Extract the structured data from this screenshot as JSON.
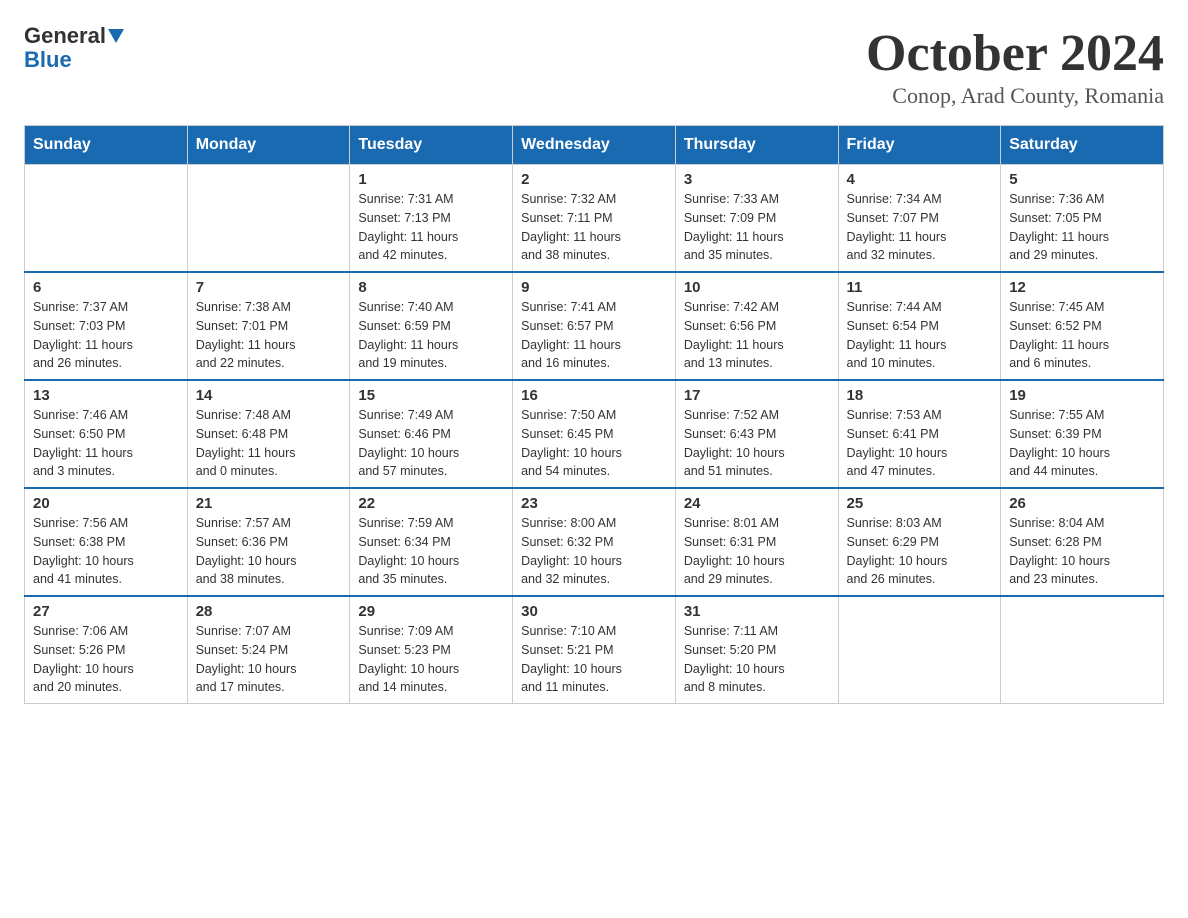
{
  "logo": {
    "general": "General",
    "blue": "Blue"
  },
  "title": "October 2024",
  "subtitle": "Conop, Arad County, Romania",
  "weekdays": [
    "Sunday",
    "Monday",
    "Tuesday",
    "Wednesday",
    "Thursday",
    "Friday",
    "Saturday"
  ],
  "weeks": [
    [
      {
        "day": "",
        "info": ""
      },
      {
        "day": "",
        "info": ""
      },
      {
        "day": "1",
        "info": "Sunrise: 7:31 AM\nSunset: 7:13 PM\nDaylight: 11 hours\nand 42 minutes."
      },
      {
        "day": "2",
        "info": "Sunrise: 7:32 AM\nSunset: 7:11 PM\nDaylight: 11 hours\nand 38 minutes."
      },
      {
        "day": "3",
        "info": "Sunrise: 7:33 AM\nSunset: 7:09 PM\nDaylight: 11 hours\nand 35 minutes."
      },
      {
        "day": "4",
        "info": "Sunrise: 7:34 AM\nSunset: 7:07 PM\nDaylight: 11 hours\nand 32 minutes."
      },
      {
        "day": "5",
        "info": "Sunrise: 7:36 AM\nSunset: 7:05 PM\nDaylight: 11 hours\nand 29 minutes."
      }
    ],
    [
      {
        "day": "6",
        "info": "Sunrise: 7:37 AM\nSunset: 7:03 PM\nDaylight: 11 hours\nand 26 minutes."
      },
      {
        "day": "7",
        "info": "Sunrise: 7:38 AM\nSunset: 7:01 PM\nDaylight: 11 hours\nand 22 minutes."
      },
      {
        "day": "8",
        "info": "Sunrise: 7:40 AM\nSunset: 6:59 PM\nDaylight: 11 hours\nand 19 minutes."
      },
      {
        "day": "9",
        "info": "Sunrise: 7:41 AM\nSunset: 6:57 PM\nDaylight: 11 hours\nand 16 minutes."
      },
      {
        "day": "10",
        "info": "Sunrise: 7:42 AM\nSunset: 6:56 PM\nDaylight: 11 hours\nand 13 minutes."
      },
      {
        "day": "11",
        "info": "Sunrise: 7:44 AM\nSunset: 6:54 PM\nDaylight: 11 hours\nand 10 minutes."
      },
      {
        "day": "12",
        "info": "Sunrise: 7:45 AM\nSunset: 6:52 PM\nDaylight: 11 hours\nand 6 minutes."
      }
    ],
    [
      {
        "day": "13",
        "info": "Sunrise: 7:46 AM\nSunset: 6:50 PM\nDaylight: 11 hours\nand 3 minutes."
      },
      {
        "day": "14",
        "info": "Sunrise: 7:48 AM\nSunset: 6:48 PM\nDaylight: 11 hours\nand 0 minutes."
      },
      {
        "day": "15",
        "info": "Sunrise: 7:49 AM\nSunset: 6:46 PM\nDaylight: 10 hours\nand 57 minutes."
      },
      {
        "day": "16",
        "info": "Sunrise: 7:50 AM\nSunset: 6:45 PM\nDaylight: 10 hours\nand 54 minutes."
      },
      {
        "day": "17",
        "info": "Sunrise: 7:52 AM\nSunset: 6:43 PM\nDaylight: 10 hours\nand 51 minutes."
      },
      {
        "day": "18",
        "info": "Sunrise: 7:53 AM\nSunset: 6:41 PM\nDaylight: 10 hours\nand 47 minutes."
      },
      {
        "day": "19",
        "info": "Sunrise: 7:55 AM\nSunset: 6:39 PM\nDaylight: 10 hours\nand 44 minutes."
      }
    ],
    [
      {
        "day": "20",
        "info": "Sunrise: 7:56 AM\nSunset: 6:38 PM\nDaylight: 10 hours\nand 41 minutes."
      },
      {
        "day": "21",
        "info": "Sunrise: 7:57 AM\nSunset: 6:36 PM\nDaylight: 10 hours\nand 38 minutes."
      },
      {
        "day": "22",
        "info": "Sunrise: 7:59 AM\nSunset: 6:34 PM\nDaylight: 10 hours\nand 35 minutes."
      },
      {
        "day": "23",
        "info": "Sunrise: 8:00 AM\nSunset: 6:32 PM\nDaylight: 10 hours\nand 32 minutes."
      },
      {
        "day": "24",
        "info": "Sunrise: 8:01 AM\nSunset: 6:31 PM\nDaylight: 10 hours\nand 29 minutes."
      },
      {
        "day": "25",
        "info": "Sunrise: 8:03 AM\nSunset: 6:29 PM\nDaylight: 10 hours\nand 26 minutes."
      },
      {
        "day": "26",
        "info": "Sunrise: 8:04 AM\nSunset: 6:28 PM\nDaylight: 10 hours\nand 23 minutes."
      }
    ],
    [
      {
        "day": "27",
        "info": "Sunrise: 7:06 AM\nSunset: 5:26 PM\nDaylight: 10 hours\nand 20 minutes."
      },
      {
        "day": "28",
        "info": "Sunrise: 7:07 AM\nSunset: 5:24 PM\nDaylight: 10 hours\nand 17 minutes."
      },
      {
        "day": "29",
        "info": "Sunrise: 7:09 AM\nSunset: 5:23 PM\nDaylight: 10 hours\nand 14 minutes."
      },
      {
        "day": "30",
        "info": "Sunrise: 7:10 AM\nSunset: 5:21 PM\nDaylight: 10 hours\nand 11 minutes."
      },
      {
        "day": "31",
        "info": "Sunrise: 7:11 AM\nSunset: 5:20 PM\nDaylight: 10 hours\nand 8 minutes."
      },
      {
        "day": "",
        "info": ""
      },
      {
        "day": "",
        "info": ""
      }
    ]
  ]
}
